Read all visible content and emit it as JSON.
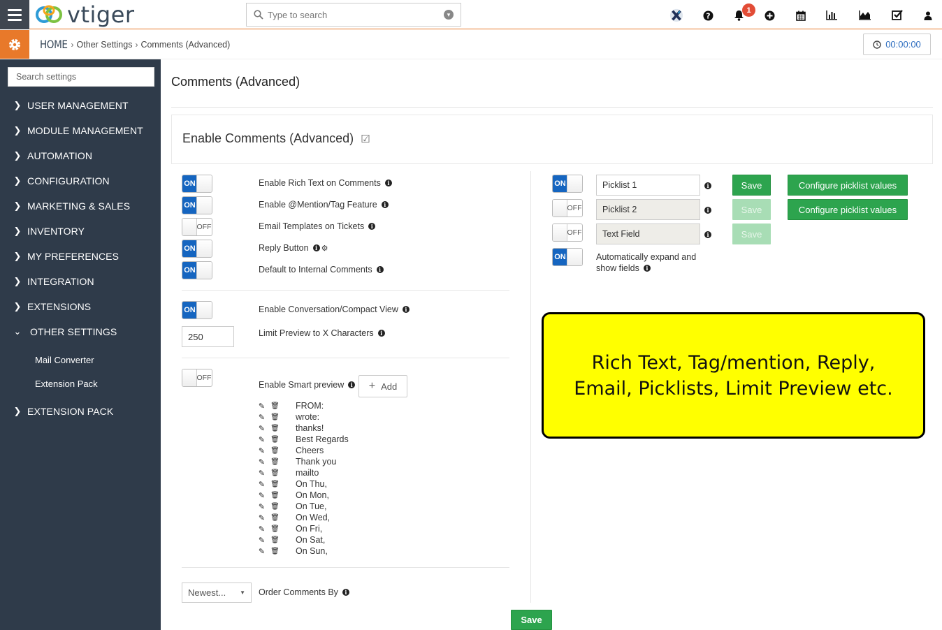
{
  "header": {
    "logo_text": "vtiger",
    "search_placeholder": "Type to search",
    "notification_count": "1",
    "icons": [
      "x-app-icon",
      "help-icon",
      "bell-icon",
      "plus-circle-icon",
      "calendar-icon",
      "bar-chart-icon",
      "area-chart-icon",
      "task-check-icon",
      "user-icon"
    ]
  },
  "breadcrumb": {
    "home": "HOME",
    "level1": "Other Settings",
    "level2": "Comments (Advanced)"
  },
  "timer": "00:00:00",
  "sidebar": {
    "search_placeholder": "Search settings",
    "items": [
      {
        "label": "USER MANAGEMENT"
      },
      {
        "label": "MODULE MANAGEMENT"
      },
      {
        "label": "AUTOMATION"
      },
      {
        "label": "CONFIGURATION"
      },
      {
        "label": "MARKETING & SALES"
      },
      {
        "label": "INVENTORY"
      },
      {
        "label": "MY PREFERENCES"
      },
      {
        "label": "INTEGRATION"
      },
      {
        "label": "EXTENSIONS"
      },
      {
        "label": "OTHER SETTINGS"
      },
      {
        "label": "EXTENSION PACK"
      }
    ],
    "sub_items": [
      {
        "label": "Mail Converter"
      },
      {
        "label": "Extension Pack"
      }
    ]
  },
  "page": {
    "title": "Comments (Advanced)",
    "enable_label": "Enable Comments (Advanced)"
  },
  "left_options": {
    "rich_text": {
      "label": "Enable Rich Text on Comments",
      "state": "ON"
    },
    "mention": {
      "label": "Enable @Mention/Tag Feature",
      "state": "ON"
    },
    "email_templates": {
      "label": "Email Templates on Tickets",
      "state": "OFF"
    },
    "reply": {
      "label": "Reply Button",
      "state": "ON"
    },
    "internal": {
      "label": "Default to Internal Comments",
      "state": "ON"
    },
    "conversation": {
      "label": "Enable Conversation/Compact View",
      "state": "ON"
    },
    "limit_preview": {
      "label": "Limit Preview to X Characters",
      "value": "250"
    },
    "smart_preview": {
      "label": "Enable Smart preview",
      "state": "OFF",
      "add_label": "Add"
    },
    "smart_words": [
      "FROM:",
      "wrote:",
      "thanks!",
      "Best Regards",
      "Cheers",
      "Thank you",
      "mailto",
      "On Thu,",
      "On Mon,",
      "On Tue,",
      "On Wed,",
      "On Fri,",
      "On Sat,",
      "On Sun,"
    ],
    "order": {
      "label": "Order Comments By",
      "value": "Newest..."
    }
  },
  "right_options": {
    "picklist1": {
      "state": "ON",
      "value": "Picklist 1",
      "save": "Save",
      "configure": "Configure picklist values"
    },
    "picklist2": {
      "state": "OFF",
      "value": "Picklist 2",
      "save": "Save",
      "configure": "Configure picklist values"
    },
    "textfield": {
      "state": "OFF",
      "value": "Text Field",
      "save": "Save"
    },
    "auto_expand": {
      "state": "ON",
      "label_line1": "Automatically expand and",
      "label_line2": "show fields"
    }
  },
  "callout": {
    "line1": "Rich Text, Tag/mention, Reply,",
    "line2": "Email, Picklists, Limit Preview etc."
  },
  "footer": {
    "save": "Save"
  },
  "colors": {
    "accent": "#e8792a",
    "sidebar": "#2f3b4a",
    "toggle_on": "#1565c0",
    "save_green": "#2da44e",
    "callout": "#ffff00"
  }
}
